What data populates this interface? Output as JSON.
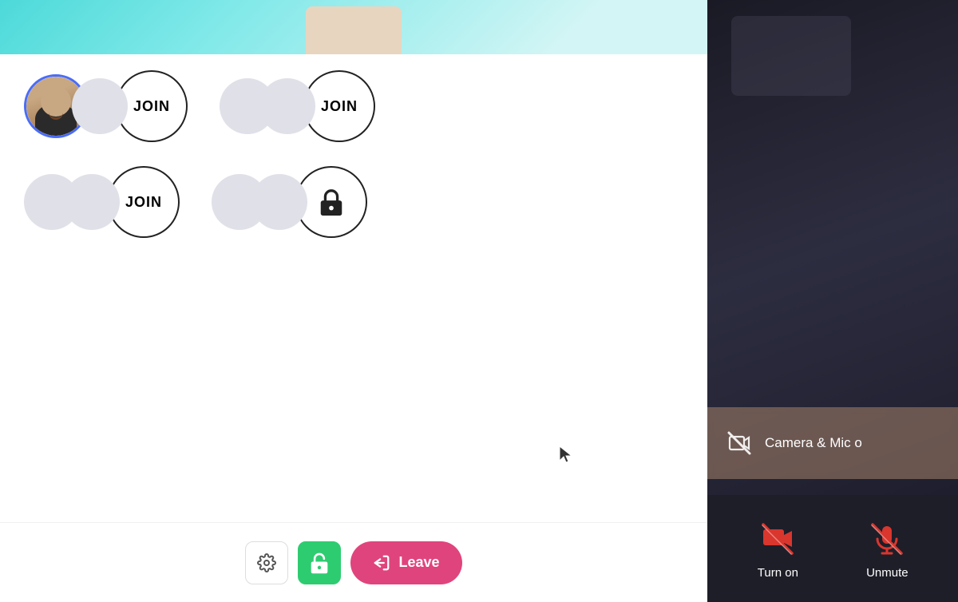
{
  "left_panel": {
    "rooms": [
      {
        "row": 1,
        "groups": [
          {
            "id": "group-1-1",
            "has_user_avatar": true,
            "avatar_count": 2,
            "join_button_label": "JOIN",
            "type": "join"
          },
          {
            "id": "group-1-2",
            "has_user_avatar": false,
            "avatar_count": 2,
            "join_button_label": "JOIN",
            "type": "join"
          }
        ]
      },
      {
        "row": 2,
        "groups": [
          {
            "id": "group-2-1",
            "has_user_avatar": false,
            "avatar_count": 2,
            "join_button_label": "JOIN",
            "type": "join"
          },
          {
            "id": "group-2-2",
            "has_user_avatar": false,
            "avatar_count": 2,
            "join_button_label": "",
            "type": "lock"
          }
        ]
      }
    ],
    "toolbar": {
      "settings_label": "⚙",
      "lock_label": "🔓",
      "leave_label": "Leave",
      "leave_icon": "←"
    }
  },
  "right_panel": {
    "cam_mic_text": "Camera & Mic o",
    "turn_on_label": "Turn on",
    "unmute_label": "Unmute"
  }
}
